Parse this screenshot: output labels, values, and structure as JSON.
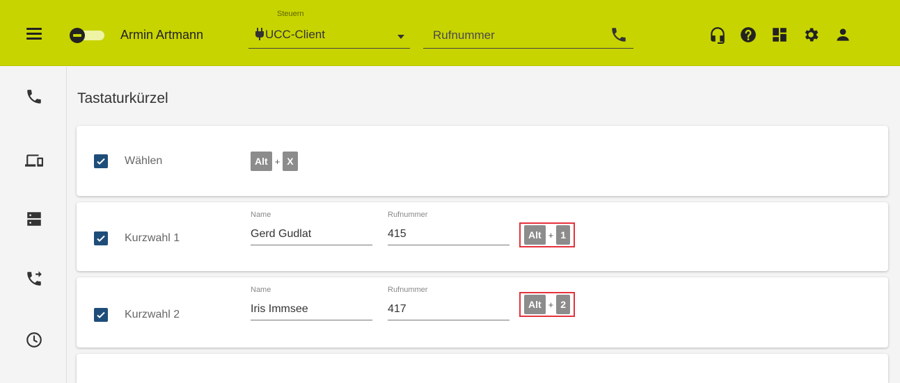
{
  "header": {
    "user_name": "Armin Artmann",
    "control_label": "Steuern",
    "device_value": "UCC-Client",
    "phone_placeholder": "Rufnummer"
  },
  "icons": {
    "menu": "hamburger-menu-icon",
    "status": "presence-toggle",
    "plug": "plug-icon",
    "call": "phone-icon",
    "headset": "headset-icon",
    "help": "help-icon",
    "dashboard": "dashboard-icon",
    "settings": "gear-icon",
    "account": "person-icon",
    "sidebar": [
      "phone-icon",
      "devices-icon",
      "server-icon",
      "call-forward-icon",
      "clock-icon"
    ]
  },
  "colors": {
    "topbar": "#c8d400",
    "checkbox": "#1f4d79",
    "highlight": "#e5313b",
    "key": "#8c8c8c"
  },
  "main": {
    "title": "Tastaturkürzel",
    "rows": [
      {
        "label": "Wählen",
        "checked": true,
        "shortcut": {
          "modifier": "Alt",
          "plus": "+",
          "key": "X"
        }
      },
      {
        "label": "Kurzwahl 1",
        "checked": true,
        "name_label": "Name",
        "name_value": "Gerd Gudlat",
        "number_label": "Rufnummer",
        "number_value": "415",
        "shortcut": {
          "modifier": "Alt",
          "plus": "+",
          "key": "1"
        }
      },
      {
        "label": "Kurzwahl 2",
        "checked": true,
        "name_label": "Name",
        "name_value": "Iris Immsee",
        "number_label": "Rufnummer",
        "number_value": "417",
        "shortcut": {
          "modifier": "Alt",
          "plus": "+",
          "key": "2"
        }
      }
    ]
  }
}
